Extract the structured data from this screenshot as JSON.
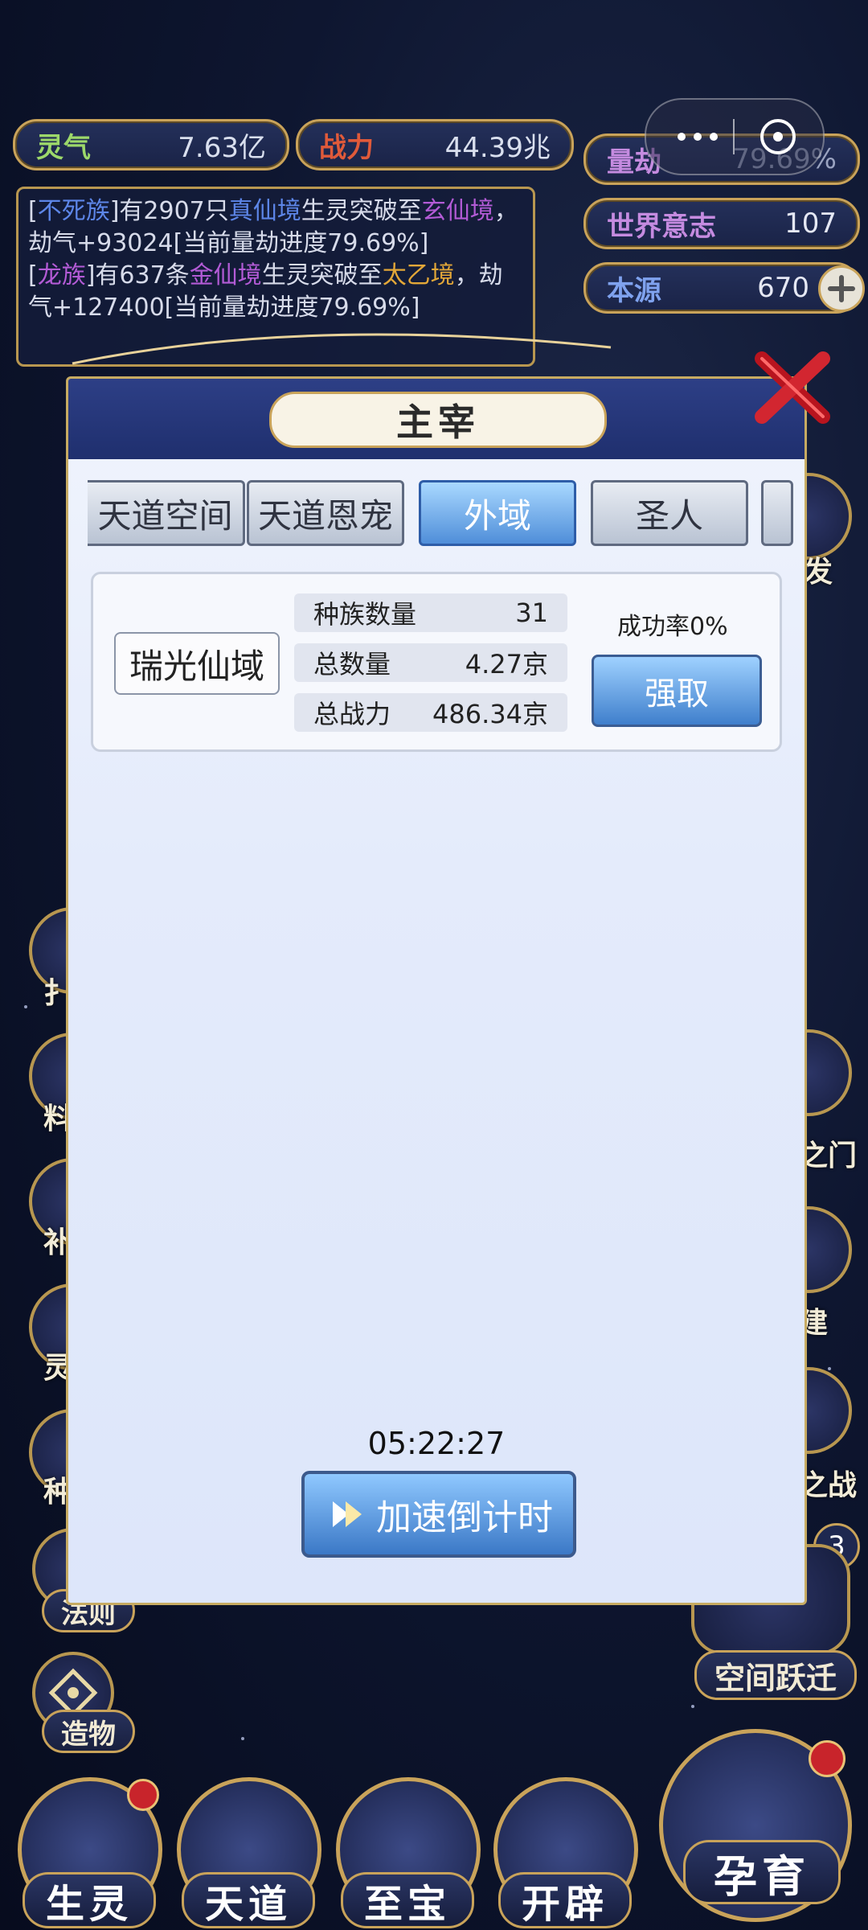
{
  "resources": {
    "lingqi_label": "灵气",
    "lingqi_value": "7.63亿",
    "zhanli_label": "战力",
    "zhanli_value": "44.39兆",
    "liangjie_label": "量劫",
    "liangjie_value": "79.69%",
    "world_will_label": "世界意志",
    "world_will_value": "107",
    "origin_label": "本源",
    "origin_value": "670"
  },
  "log": {
    "entry1": {
      "open": "[",
      "race": "不死族",
      "text1": "]有2907只",
      "realm1": "真仙境",
      "text2": "生灵突破至",
      "realm2": "玄仙境",
      "text3": "，劫气+93024[当前量劫进度79.69%]"
    },
    "entry2": {
      "open": "[",
      "race": "龙族",
      "text1": "]有637条",
      "realm1": "金仙境",
      "text2": "生灵突破至",
      "realm2": "太乙境",
      "text3": "，劫气+127400[当前量劫进度79.69%]"
    }
  },
  "side_left": [
    "扌",
    "料",
    "补",
    "灵",
    "种",
    "法则",
    "造物"
  ],
  "side_right": [
    "发",
    "之门",
    "建",
    "之战",
    "空间跃迁"
  ],
  "badge_count": "3",
  "bottom_nav": [
    "生灵",
    "天道",
    "至宝",
    "开辟",
    "孕育"
  ],
  "modal": {
    "title": "主宰",
    "tabs": [
      "天道空间",
      "天道恩宠",
      "外域",
      "圣人"
    ],
    "active_tab": "外域",
    "region_name": "瑞光仙域",
    "stats": [
      {
        "label": "种族数量",
        "value": "31"
      },
      {
        "label": "总数量",
        "value": "4.27京"
      },
      {
        "label": "总战力",
        "value": "486.34京"
      }
    ],
    "success_rate": "成功率0%",
    "seize_label": "强取",
    "timer": "05:22:27",
    "speedup_label": "加速倒计时"
  },
  "colors": {
    "gold_border": "#c9a35a",
    "tab_active": "#4f8ed9",
    "red_dot": "#c8242b"
  }
}
